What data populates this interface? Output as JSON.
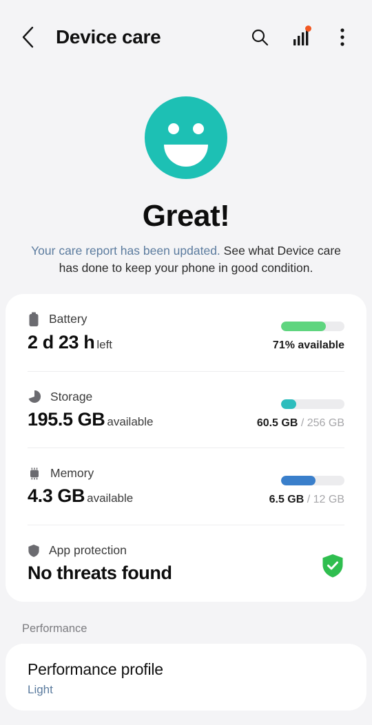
{
  "header": {
    "back_icon": "chevron-left-icon",
    "title": "Device care",
    "search_icon": "search-icon",
    "stats_icon": "bar-chart-icon",
    "stats_has_badge": true,
    "menu_icon": "more-vertical-icon"
  },
  "hero": {
    "face_icon": "smiley-face-icon",
    "face_color": "#1dc0b4",
    "title": "Great!",
    "desc_link": "Your care report has been updated.",
    "desc_rest": " See what Device care has done to keep your phone in good condition.",
    "link_color": "#5b7b9e"
  },
  "status_card": {
    "rows": [
      {
        "id": "battery",
        "icon": "battery-icon",
        "label": "Battery",
        "value": "2 d 23 h",
        "unit": "left",
        "bar_percent": 71,
        "bar_color": "#5fd57f",
        "caption": "71% available",
        "caption_muted": ""
      },
      {
        "id": "storage",
        "icon": "pie-chart-icon",
        "label": "Storage",
        "value": "195.5 GB",
        "unit": "available",
        "bar_percent": 24,
        "bar_color": "#2dbdbd",
        "caption": "60.5 GB",
        "caption_muted": " / 256 GB"
      },
      {
        "id": "memory",
        "icon": "memory-chip-icon",
        "label": "Memory",
        "value": "4.3 GB",
        "unit": "available",
        "bar_percent": 54,
        "bar_color": "#3a7fcb",
        "caption": "6.5 GB",
        "caption_muted": " / 12 GB"
      }
    ],
    "protection": {
      "icon": "shield-icon",
      "label": "App protection",
      "value": "No threats found",
      "badge_icon": "shield-check-icon",
      "badge_color": "#2fbe4f"
    }
  },
  "performance": {
    "section_label": "Performance",
    "profile_title": "Performance profile",
    "profile_value": "Light"
  }
}
